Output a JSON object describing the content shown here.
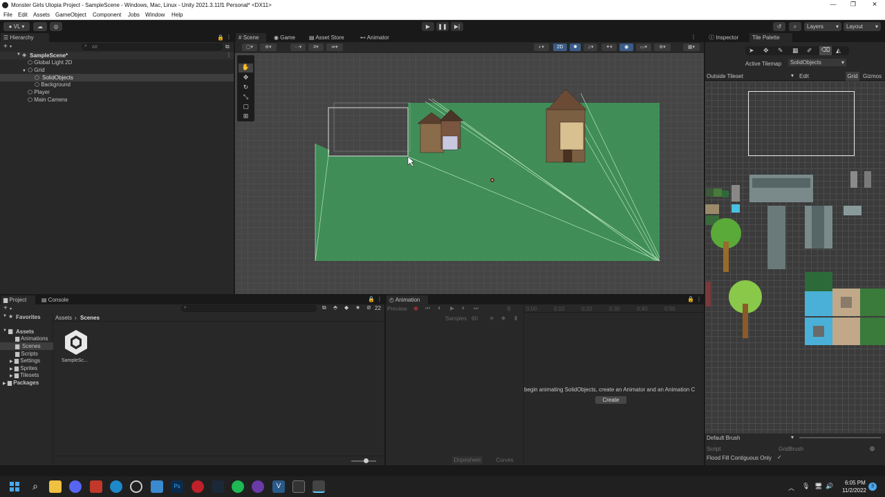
{
  "window": {
    "title": "Monster Girls Utopia Project - SampleScene - Windows, Mac, Linux - Unity 2021.3.11f1 Personal* <DX11>",
    "minimize": "—",
    "maximize": "❐",
    "close": "✕"
  },
  "menu": [
    "File",
    "Edit",
    "Assets",
    "GameObject",
    "Component",
    "Jobs",
    "Window",
    "Help"
  ],
  "toolbar": {
    "account": "VL",
    "layers": "Layers",
    "layout": "Layout"
  },
  "hierarchy": {
    "tab": "Hierarchy",
    "search_placeholder": "All",
    "items": [
      {
        "label": "SampleScene*"
      },
      {
        "label": "Global Light 2D"
      },
      {
        "label": "Grid"
      },
      {
        "label": "SolidObjects"
      },
      {
        "label": "Background"
      },
      {
        "label": "Player"
      },
      {
        "label": "Main Camera"
      }
    ]
  },
  "scene": {
    "tabs": [
      "Scene",
      "Game",
      "Asset Store",
      "Animator"
    ],
    "mode_2d": "2D"
  },
  "inspector": {
    "tabs": [
      "Inspector",
      "Tile Palette"
    ],
    "active_tilemap_label": "Active Tilemap",
    "active_tilemap_value": "SolidObjects",
    "palette": "Outside Tileset",
    "edit": "Edit",
    "grid": "Grid",
    "gizmos": "Gizmos",
    "brush": "Default Brush",
    "script_label": "Script",
    "script_value": "GridBrush",
    "flood_fill_label": "Flood Fill Contiguous Only",
    "flood_fill_check": "✓"
  },
  "project": {
    "tabs": [
      "Project",
      "Console"
    ],
    "favorites": "Favorites",
    "assets": "Assets",
    "folders": [
      "Animations",
      "Scenes",
      "Scripts",
      "Settings",
      "Sprites",
      "Tilesets"
    ],
    "packages": "Packages",
    "breadcrumb": [
      "Assets",
      "Scenes"
    ],
    "file": "SampleSc...",
    "hidden_count": "22"
  },
  "animation": {
    "tab": "Animation",
    "preview": "Preview",
    "frame": "0",
    "samples_label": "Samples",
    "samples_value": "60",
    "ticks": [
      "0:00",
      "0:10",
      "0:20",
      "0:30",
      "0:40",
      "0:50"
    ],
    "message": "begin animating SolidObjects, create an Animator and an Animation C",
    "create": "Create",
    "dopesheet": "Dopesheet",
    "curves": "Curves"
  },
  "taskbar": {
    "time": "6:05 PM",
    "date": "11/2/2022",
    "notifications": "3"
  },
  "colors": {
    "accent": "#3a72b0",
    "tilemap_green": "#3f9a5c",
    "panel": "#282828"
  }
}
